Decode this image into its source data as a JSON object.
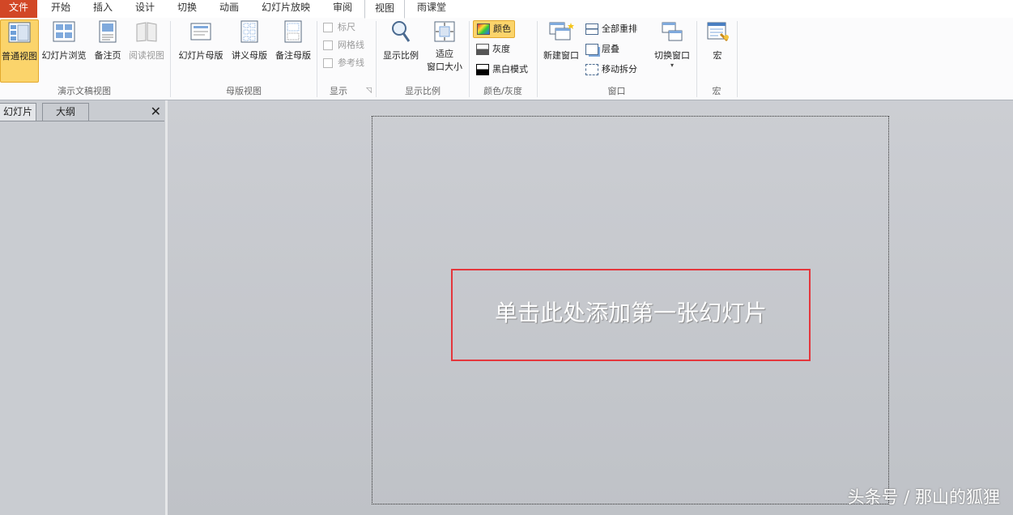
{
  "tabs": {
    "file": "文件",
    "home": "开始",
    "insert": "插入",
    "design": "设计",
    "transitions": "切换",
    "animations": "动画",
    "slideshow": "幻灯片放映",
    "review": "审阅",
    "view": "视图",
    "yuketang": "雨课堂"
  },
  "ribbon": {
    "presentation_views": {
      "label": "演示文稿视图",
      "normal": "普通视图",
      "slide_sorter": "幻灯片浏览",
      "notes_page": "备注页",
      "reading_view": "阅读视图"
    },
    "master_views": {
      "label": "母版视图",
      "slide_master": "幻灯片母版",
      "handout_master": "讲义母版",
      "notes_master": "备注母版"
    },
    "show": {
      "label": "显示",
      "ruler": "标尺",
      "gridlines": "网格线",
      "guides": "参考线"
    },
    "zoom": {
      "label": "显示比例",
      "zoom": "显示比例",
      "fit_line1": "适应",
      "fit_line2": "窗口大小"
    },
    "color": {
      "label": "颜色/灰度",
      "color": "颜色",
      "grayscale": "灰度",
      "bw": "黑白模式"
    },
    "window": {
      "label": "窗口",
      "new_window": "新建窗口",
      "arrange_all": "全部重排",
      "cascade": "层叠",
      "move_split": "移动拆分",
      "switch_windows": "切换窗口"
    },
    "macros": {
      "label": "宏",
      "macros": "宏"
    }
  },
  "left_pane": {
    "slides_tab": "幻灯片",
    "outline_tab": "大纲"
  },
  "slide": {
    "prompt": "单击此处添加第一张幻灯片"
  },
  "watermark": "头条号 / 那山的狐狸",
  "colors": {
    "file_tab": "#d24726",
    "selected": "#fbd46b",
    "highlight_box": "#e4363c",
    "workspace": "#c4c7cc"
  }
}
